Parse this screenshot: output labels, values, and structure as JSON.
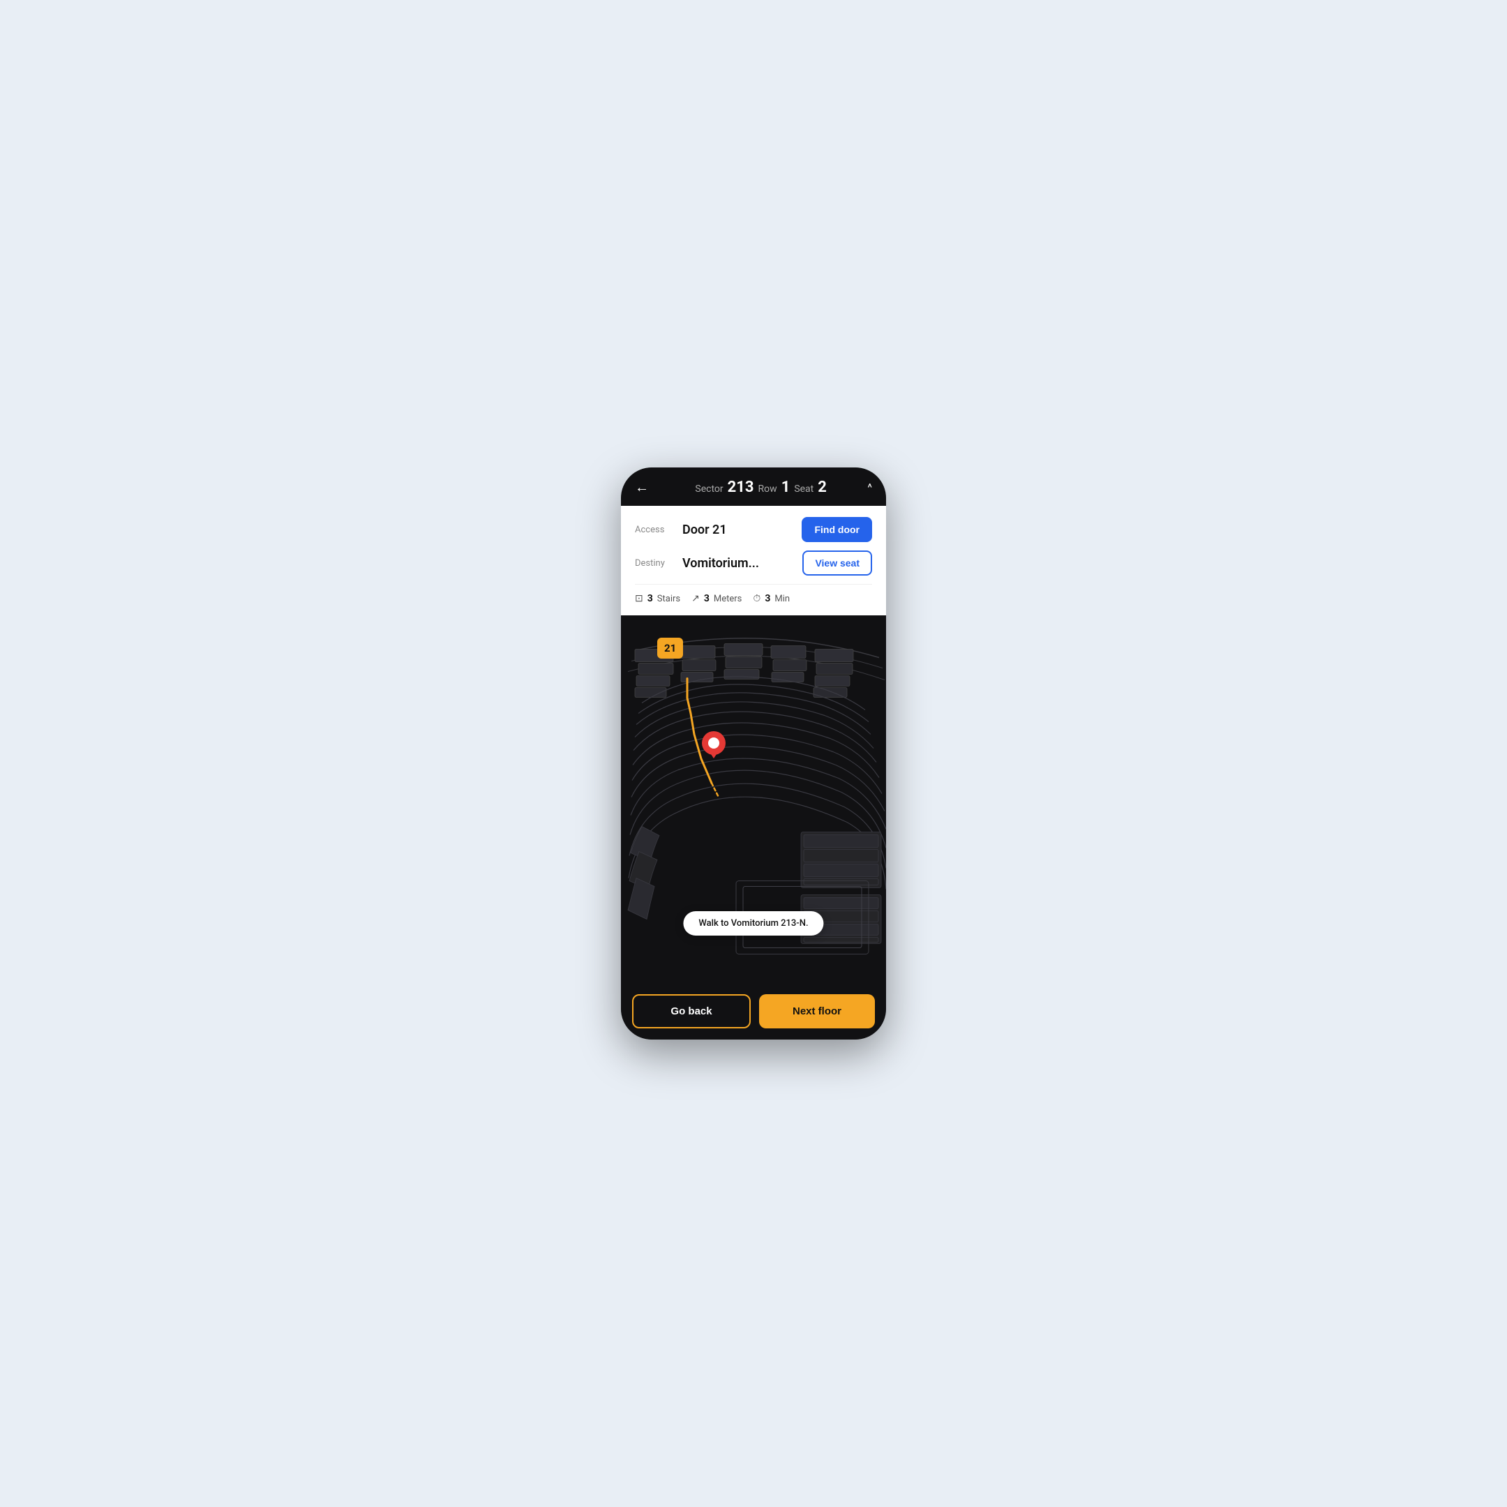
{
  "header": {
    "back_icon": "←",
    "sector_label": "Sector",
    "sector_value": "213",
    "row_label": "Row",
    "row_value": "1",
    "seat_label": "Seat",
    "seat_value": "2",
    "chevron_icon": "^"
  },
  "info_panel": {
    "access_label": "Access",
    "access_value": "Door 21",
    "find_door_btn": "Find door",
    "destiny_label": "Destiny",
    "destiny_value": "Vomitorium...",
    "view_seat_btn": "View seat",
    "stairs_icon": "⊡",
    "stairs_count": "3",
    "stairs_label": "Stairs",
    "distance_icon": "↗",
    "distance_count": "3",
    "distance_label": "Meters",
    "time_icon": "⏱",
    "time_count": "3",
    "time_label": "Min"
  },
  "map": {
    "door_number": "21",
    "walk_instruction": "Walk to Vomitorium 213-N."
  },
  "buttons": {
    "go_back": "Go back",
    "next_floor": "Next floor"
  }
}
